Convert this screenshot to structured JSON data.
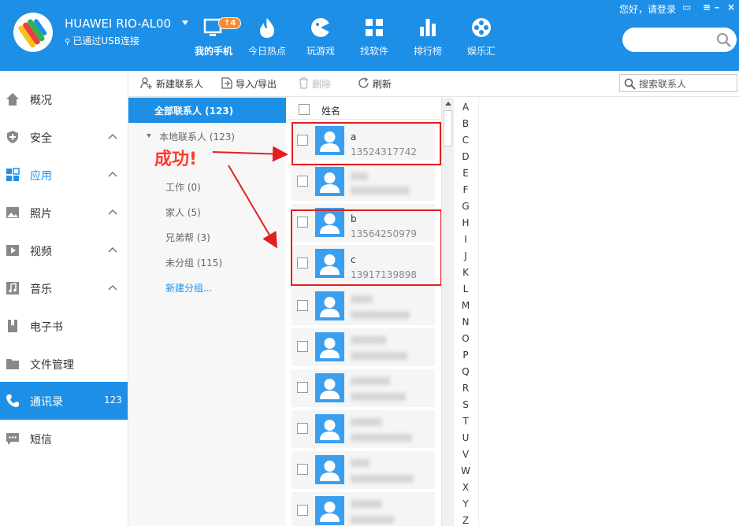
{
  "header": {
    "device_name": "HUAWEI RIO-AL00",
    "usb_status": "已通过USB连接",
    "login_text": "您好，请登录",
    "badge_count": "↑4",
    "tabs": [
      {
        "label": "我的手机",
        "icon": "phone-monitor-icon",
        "active": true
      },
      {
        "label": "今日热点",
        "icon": "flame-icon"
      },
      {
        "label": "玩游戏",
        "icon": "gamepad-icon"
      },
      {
        "label": "找软件",
        "icon": "apps-grid-icon"
      },
      {
        "label": "排行榜",
        "icon": "bar-chart-icon"
      },
      {
        "label": "娱乐汇",
        "icon": "film-reel-icon"
      }
    ],
    "search_placeholder": ""
  },
  "sidebar": {
    "items": [
      {
        "label": "概况",
        "icon": "home-icon"
      },
      {
        "label": "安全",
        "icon": "shield-icon",
        "expandable": true
      },
      {
        "label": "应用",
        "icon": "apps-icon",
        "expandable": true,
        "highlight": true
      },
      {
        "label": "照片",
        "icon": "photo-icon",
        "expandable": true
      },
      {
        "label": "视频",
        "icon": "video-icon",
        "expandable": true
      },
      {
        "label": "音乐",
        "icon": "music-icon",
        "expandable": true
      },
      {
        "label": "电子书",
        "icon": "book-icon"
      },
      {
        "label": "文件管理",
        "icon": "folder-icon"
      },
      {
        "label": "通讯录",
        "icon": "phone-icon",
        "active": true,
        "count": "123"
      },
      {
        "label": "短信",
        "icon": "message-icon"
      }
    ]
  },
  "toolbar": {
    "new_contact": "新建联系人",
    "import_export": "导入/导出",
    "delete": "删除",
    "refresh": "刷新",
    "search_placeholder": "搜索联系人"
  },
  "groups": {
    "all": "全部联系人 (123)",
    "local": "本地联系人 (123)",
    "items": [
      "工作 (0)",
      "家人 (5)",
      "兄弟帮 (3)",
      "未分组 (115)"
    ],
    "new_group": "新建分组..."
  },
  "annotation": {
    "text": "成功!"
  },
  "list": {
    "header_name": "姓名",
    "contacts": [
      {
        "name": "a",
        "phone": "13524317742"
      },
      {
        "name": "",
        "phone": ""
      },
      {
        "name": "b",
        "phone": "13564250979"
      },
      {
        "name": "c",
        "phone": "13917139898"
      },
      {
        "name": "",
        "phone": ""
      },
      {
        "name": "",
        "phone": ""
      },
      {
        "name": "",
        "phone": ""
      },
      {
        "name": "",
        "phone": ""
      },
      {
        "name": "",
        "phone": ""
      },
      {
        "name": "",
        "phone": ""
      }
    ]
  },
  "alpha_index": [
    "A",
    "B",
    "C",
    "D",
    "E",
    "F",
    "G",
    "H",
    "I",
    "J",
    "K",
    "L",
    "M",
    "N",
    "O",
    "P",
    "Q",
    "R",
    "S",
    "T",
    "U",
    "V",
    "W",
    "X",
    "Y",
    "Z"
  ],
  "colors": {
    "brand": "#1e8fe6",
    "highlight": "#e02020"
  }
}
